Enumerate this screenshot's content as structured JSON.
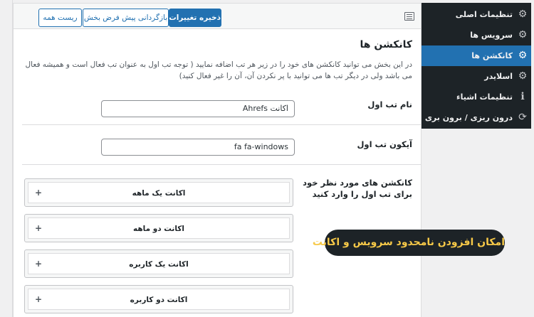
{
  "toolbar": {
    "save_label": "ذخیره تغییرات",
    "restore_default_label": "بازگردانی پیش فرض بخش",
    "reset_all_label": "ریست همه"
  },
  "section": {
    "title": "کانکشن ها",
    "description": "در این بخش می توانید کانکشن های خود را در زیر هر تب اضافه نمایید ( توجه تب اول به عنوان تب فعال است و همیشه فعال می باشد ولی در دیگر تب ها می توانید با پر نکردن آن، آن را غیر فعال کنید)"
  },
  "fields": {
    "tab_name": {
      "label": "نام تب اول",
      "value": "اکانت Ahrefs"
    },
    "tab_icon": {
      "label": "آیکون تب اول",
      "value": "fa fa-windows"
    },
    "connections": {
      "label": "کانکشن های مورد نظر خود برای تب اول را وارد کنید"
    }
  },
  "accordions": [
    {
      "title": "اکانت یک ماهه",
      "toggle": "+"
    },
    {
      "title": "اکانت دو ماهه",
      "toggle": "+"
    },
    {
      "title": "اکانت یک کاربره",
      "toggle": "+"
    },
    {
      "title": "اکانت دو کاربره",
      "toggle": "+"
    }
  ],
  "sidebar": {
    "items": [
      {
        "label": "تنظیمات اصلی",
        "icon": "gear-icon",
        "glyph": "⚙"
      },
      {
        "label": "سرویس ها",
        "icon": "gear-icon",
        "glyph": "⚙"
      },
      {
        "label": "کانکشن ها",
        "icon": "gear-icon",
        "glyph": "⚙",
        "active": true
      },
      {
        "label": "اسلایدر",
        "icon": "gear-icon",
        "glyph": "⚙"
      },
      {
        "label": "تنظیمات اشیاء",
        "icon": "info-icon",
        "glyph": "ℹ"
      },
      {
        "label": "درون ریزی / برون بری",
        "icon": "refresh-icon",
        "glyph": "⟳"
      }
    ]
  },
  "callout": {
    "text": "امکان افزودن نامحدود سرویس و اکانت"
  },
  "colors": {
    "accent": "#2271b1",
    "sidebar_bg": "#1d2327",
    "callout_text": "#f7c948"
  }
}
